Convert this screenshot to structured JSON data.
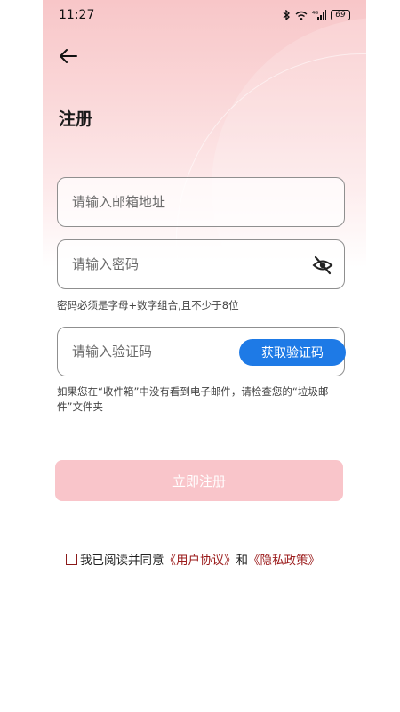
{
  "status_bar": {
    "time": "11:27",
    "network": "4G",
    "battery": "69"
  },
  "header": {
    "title": "注册"
  },
  "form": {
    "email_placeholder": "请输入邮箱地址",
    "password_placeholder": "请输入密码",
    "password_hint": "密码必须是字母+数字组合,且不少于8位",
    "code_placeholder": "请输入验证码",
    "get_code_label": "获取验证码",
    "mail_hint": "如果您在“收件箱”中没有看到电子邮件，请检查您的“垃圾邮件”文件夹",
    "submit_label": "立即注册"
  },
  "agreement": {
    "prefix": "我已阅读并同意",
    "user_agreement": "《用户协议》",
    "conjunction": "和",
    "privacy_policy": "《隐私政策》"
  },
  "colors": {
    "accent_blue": "#1e7ae6",
    "submit_disabled": "#f9c5ca",
    "link_red": "#9b1b1b",
    "header_pink": "#f8c6c8"
  }
}
